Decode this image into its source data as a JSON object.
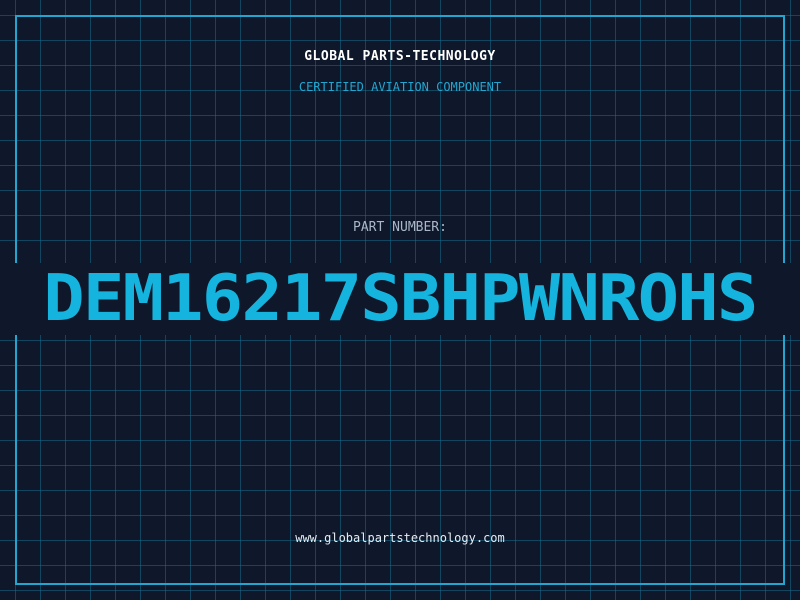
{
  "header": {
    "company": "GLOBAL PARTS-TECHNOLOGY",
    "subtitle": "CERTIFIED AVIATION COMPONENT"
  },
  "part": {
    "label": "PART NUMBER:",
    "number": "DEM16217SBHPWNROHS"
  },
  "footer": {
    "website": "www.globalpartstechnology.com"
  },
  "colors": {
    "background": "#0f172a",
    "accent": "#22a6cf",
    "part_number": "#14b4de",
    "label": "#a9b8c9",
    "text": "#ffffff"
  }
}
